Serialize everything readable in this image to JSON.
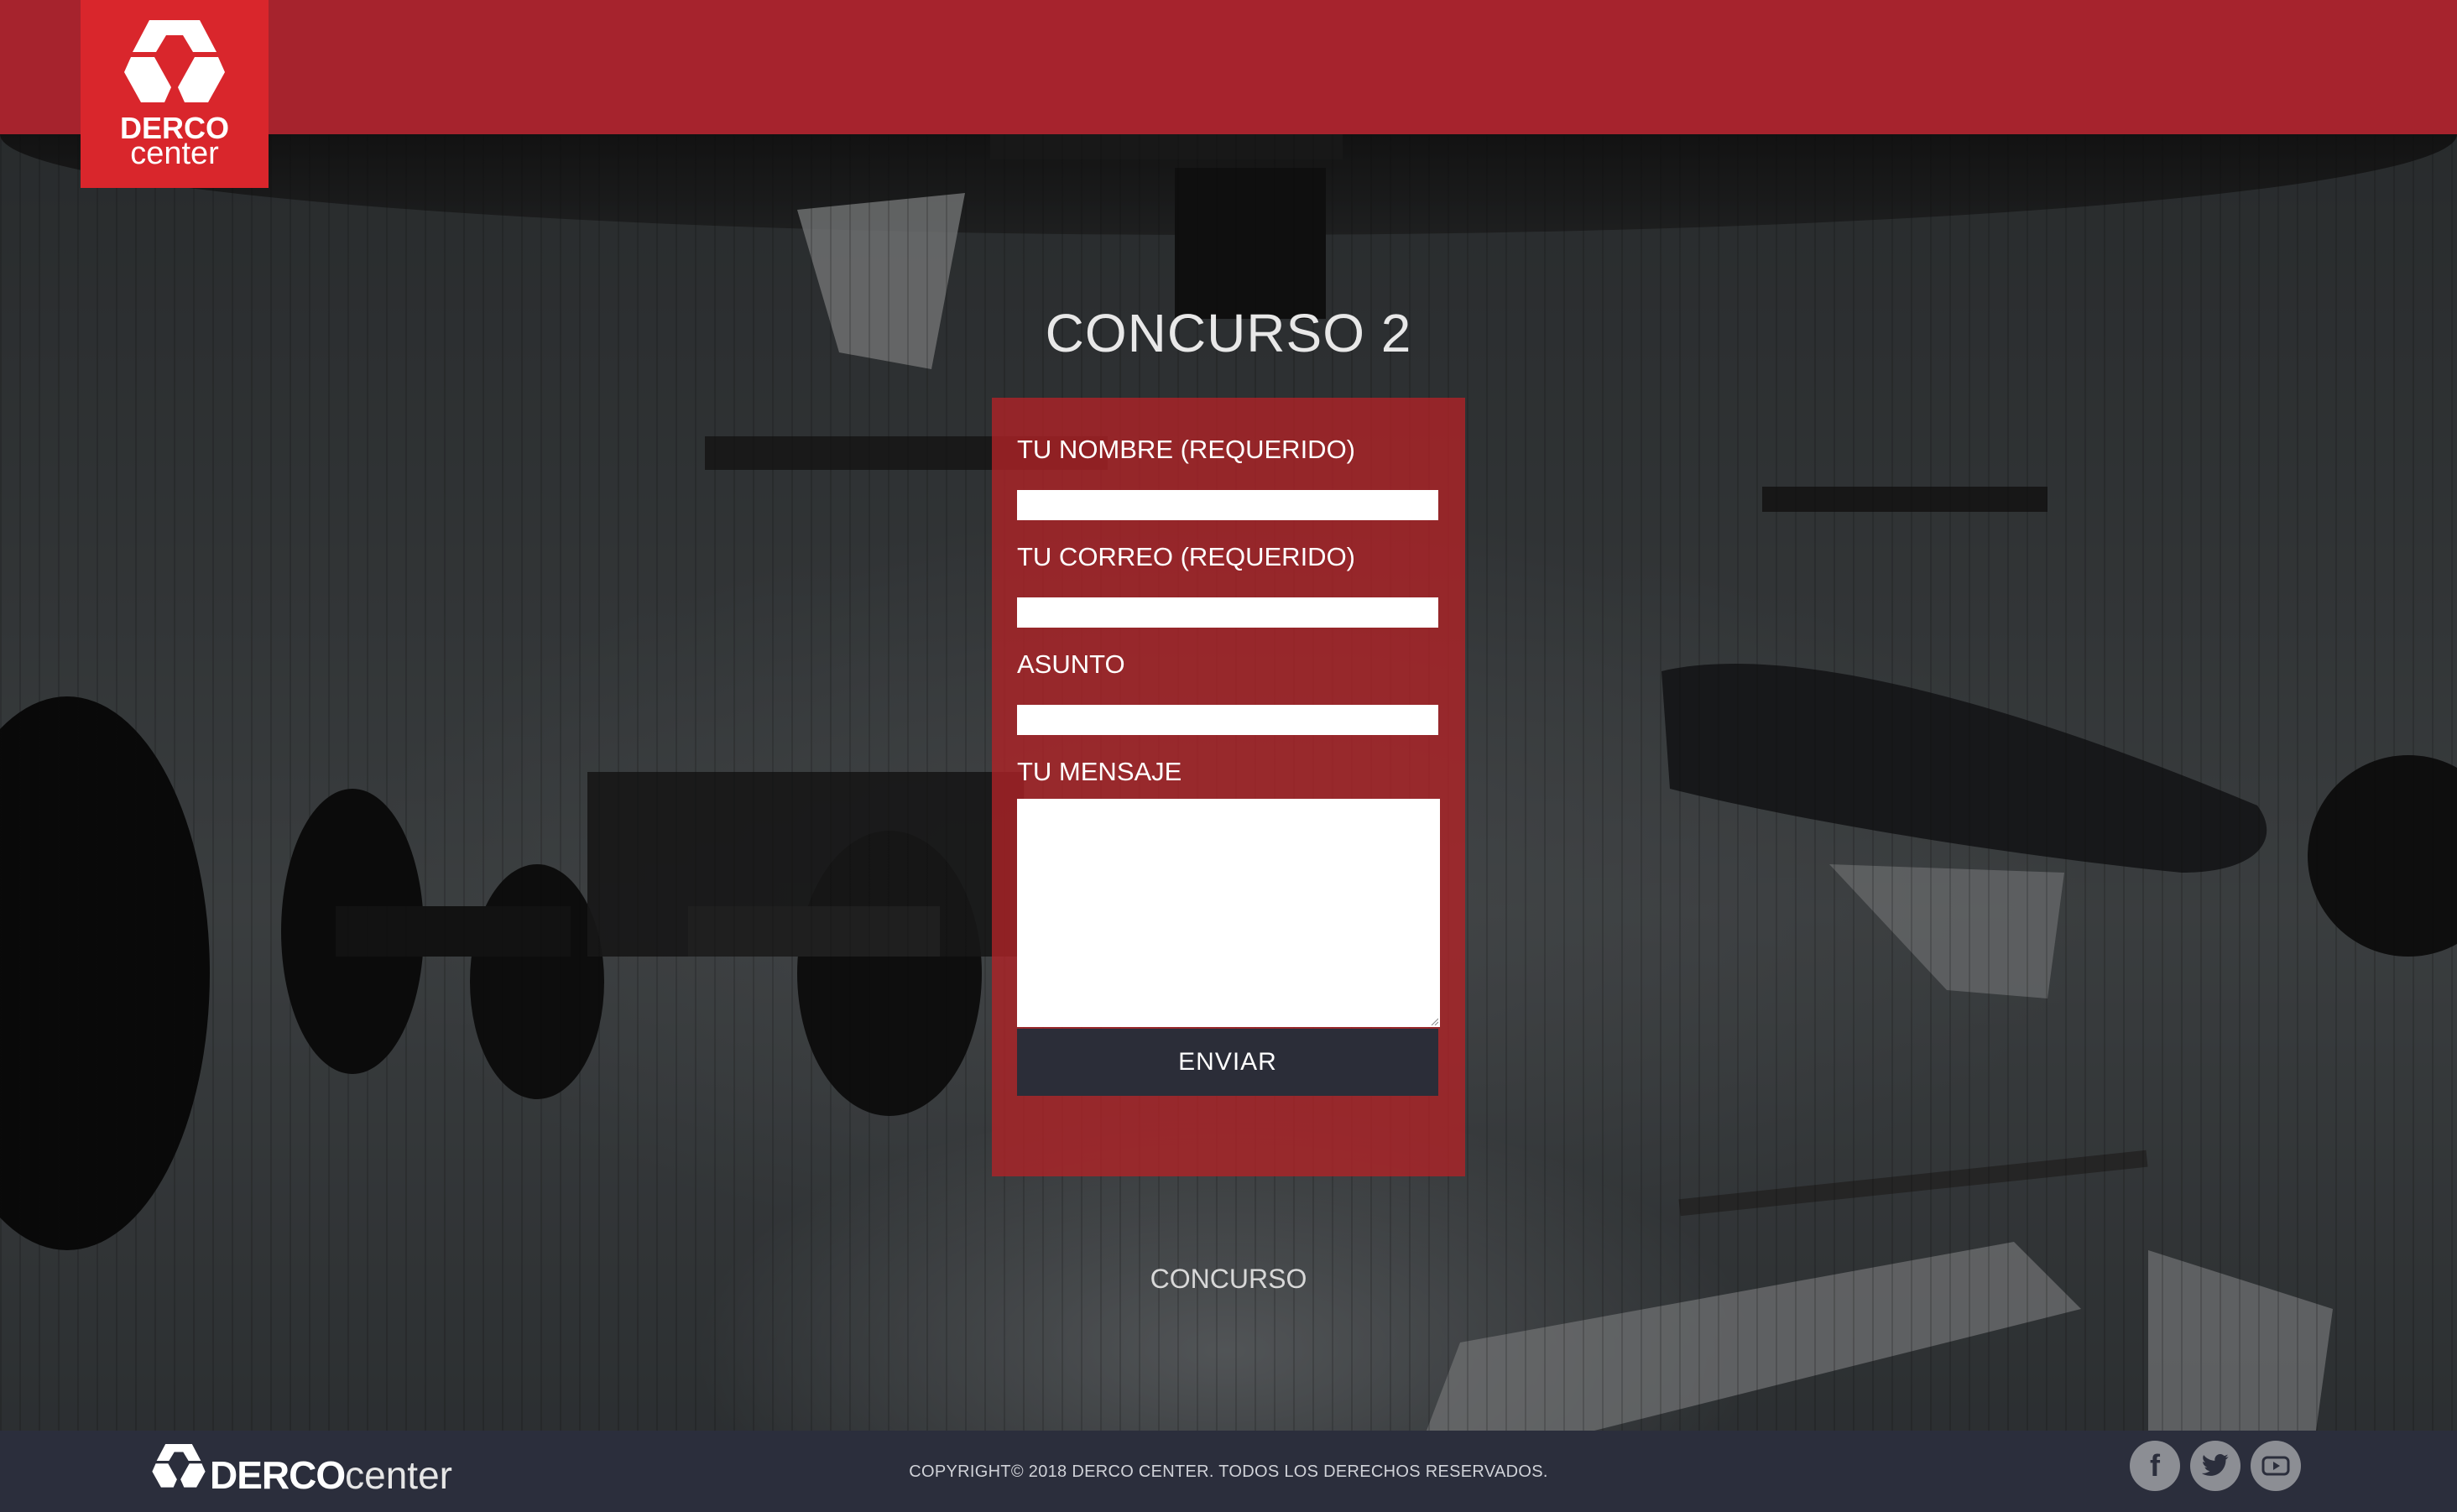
{
  "header": {
    "logo_top": "DERCO",
    "logo_bottom": "center"
  },
  "main": {
    "title": "CONCURSO 2",
    "form": {
      "name_label": "TU NOMBRE (REQUERIDO)",
      "name_value": "",
      "email_label": "TU CORREO (REQUERIDO)",
      "email_value": "",
      "subject_label": "ASUNTO",
      "subject_value": "",
      "message_label": "TU MENSAJE",
      "message_value": "",
      "submit_label": "ENVIAR"
    },
    "link_label": "CONCURSO"
  },
  "footer": {
    "brand_bold": "DERCO",
    "brand_light": "center",
    "copyright": "COPYRIGHT© 2018 DERCO CENTER. TODOS LOS DERECHOS RESERVADOS.",
    "social": [
      {
        "name": "facebook-icon",
        "glyph": "f"
      },
      {
        "name": "twitter-icon",
        "glyph": ""
      },
      {
        "name": "youtube-icon",
        "glyph": ""
      }
    ]
  },
  "colors": {
    "header_bg": "#a6232d",
    "logo_bg": "#d9262c",
    "form_bg": "#b22226",
    "button_bg": "#2b2d38",
    "footer_bg": "#2b2e3c",
    "social_bg": "#8c8e94"
  }
}
